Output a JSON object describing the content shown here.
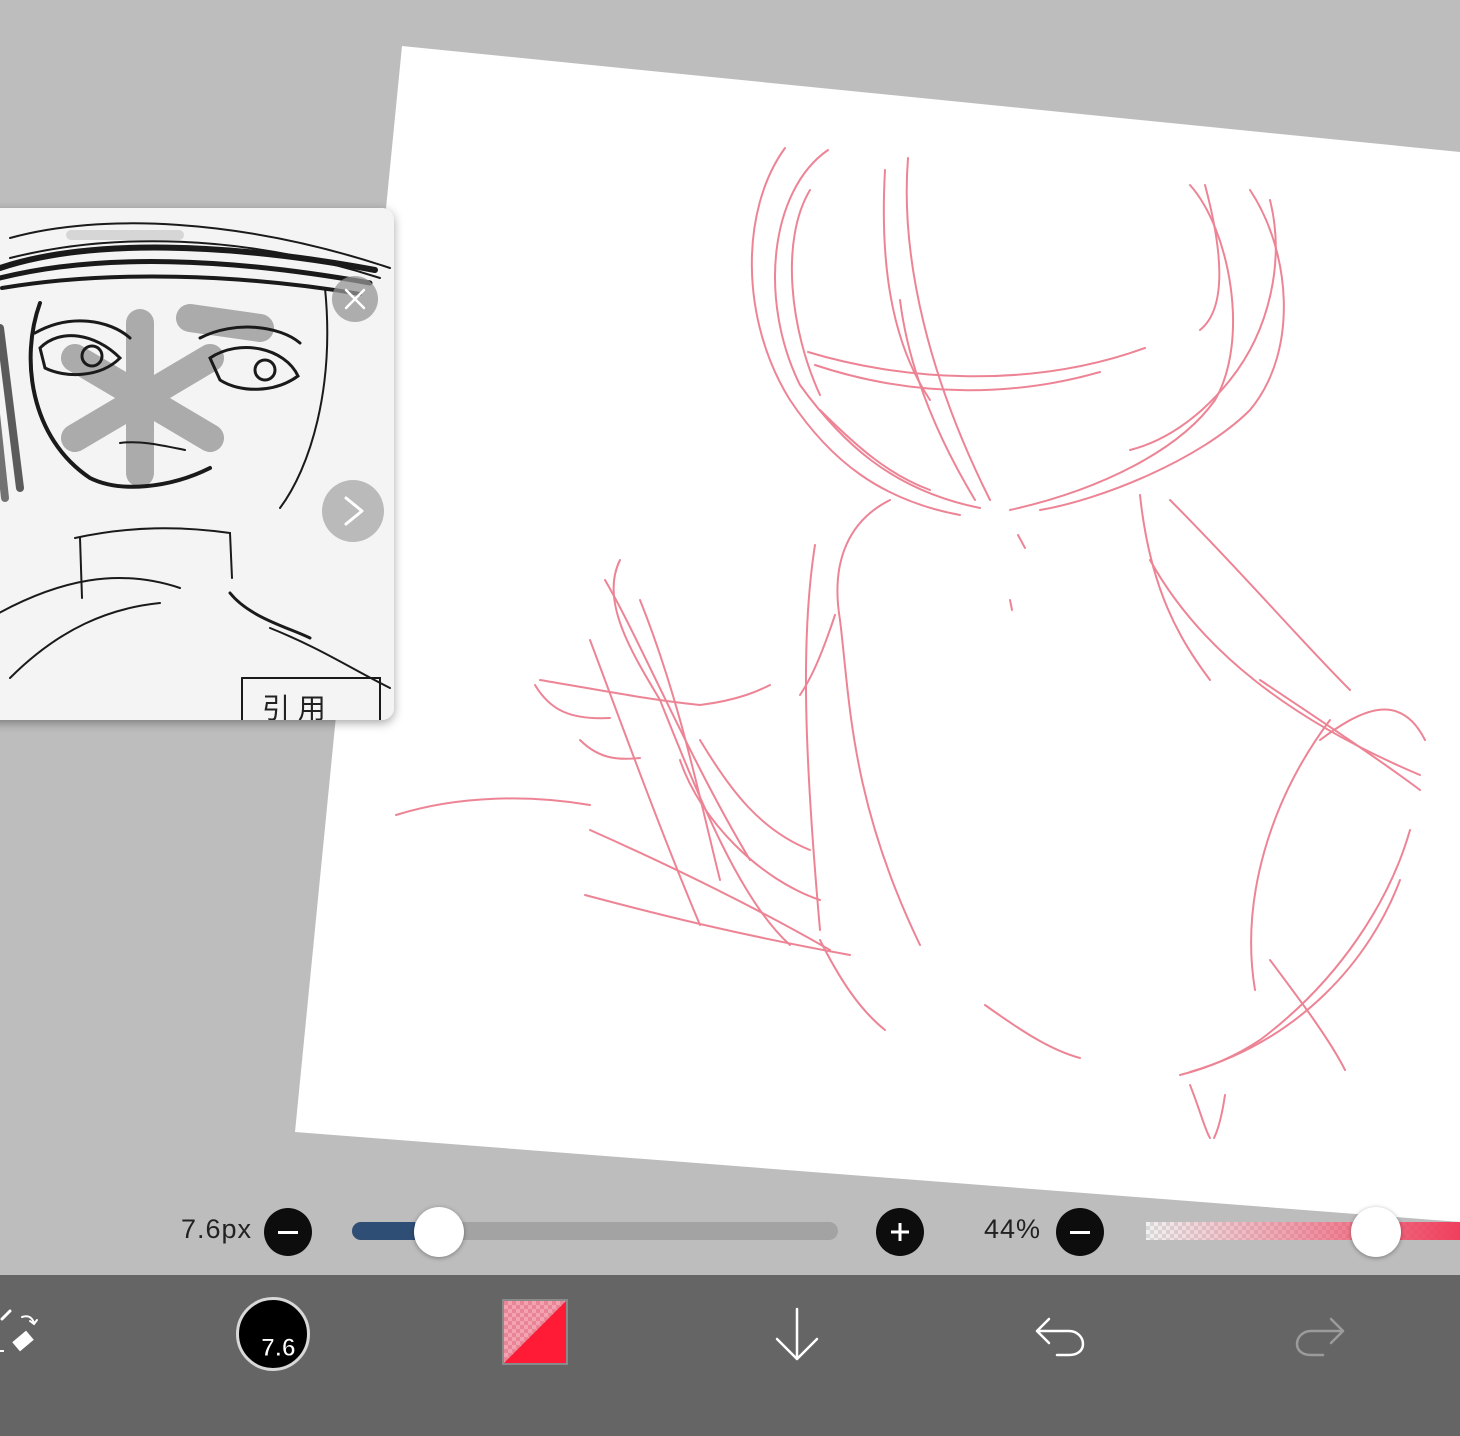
{
  "reference_panel": {
    "close_icon": "close-icon",
    "next_icon": "chevron-right-icon",
    "caption_text": "引 用"
  },
  "brush_size": {
    "label": "7.6px",
    "fraction": 0.13,
    "minus_icon": "minus-icon",
    "plus_icon": "plus-icon"
  },
  "opacity": {
    "label": "44%",
    "fraction": 0.72,
    "minus_icon": "minus-icon"
  },
  "toolbar": {
    "tool_switch_icon": "pen-eraser-swap-icon",
    "brush_preview_size": "7.6",
    "primary_color": "#ff1a35",
    "secondary_color": "#f08a9c",
    "layer_down_icon": "arrow-down-icon",
    "undo_icon": "undo-icon",
    "redo_icon": "redo-icon"
  },
  "colors": {
    "workspace_bg": "#bdbdbd",
    "sketch_stroke": "#ea6f83",
    "toolbar_bg": "#656565",
    "slider_fill": "#2f4e75"
  }
}
